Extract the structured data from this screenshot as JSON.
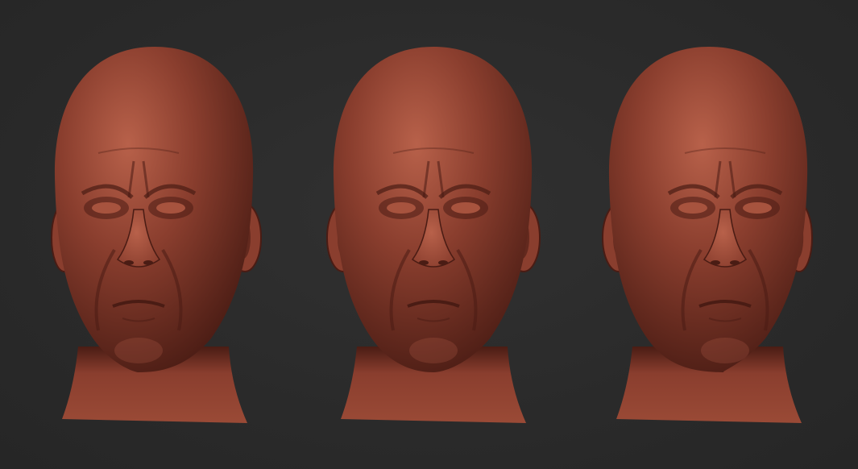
{
  "scene": {
    "background_color": "#2b2b2b",
    "clay_color": "#8a3e2e",
    "clay_highlight": "#b8614a",
    "clay_shadow": "#4a1c14",
    "views": [
      {
        "id": "three-quarter-left",
        "turn": -1
      },
      {
        "id": "front",
        "turn": 0
      },
      {
        "id": "three-quarter-right",
        "turn": 1
      }
    ]
  }
}
